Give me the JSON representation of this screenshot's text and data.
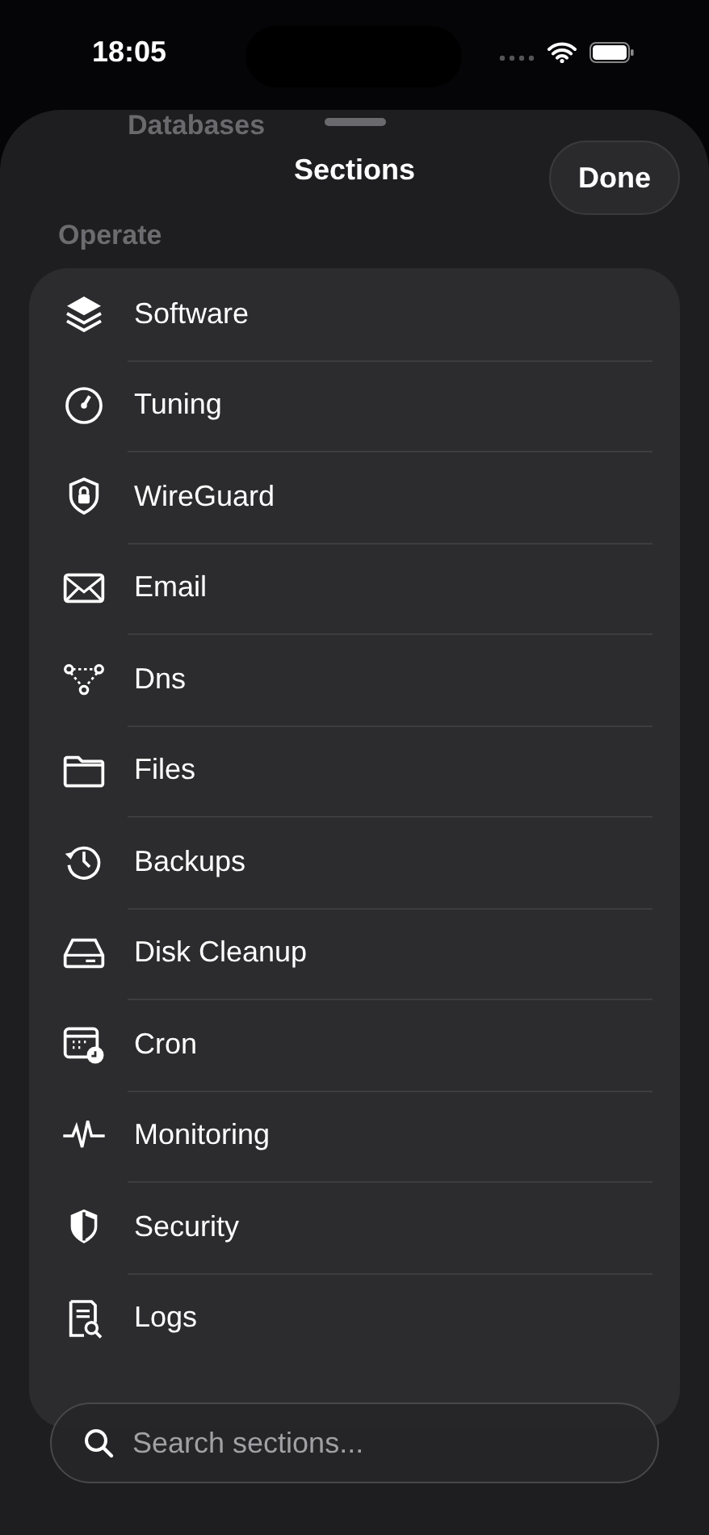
{
  "status_bar": {
    "time": "18:05"
  },
  "background_row": {
    "label": "Databases"
  },
  "sheet": {
    "title": "Sections",
    "done_button": "Done"
  },
  "section": {
    "header": "Operate"
  },
  "items": [
    {
      "label": "Software"
    },
    {
      "label": "Tuning"
    },
    {
      "label": "WireGuard"
    },
    {
      "label": "Email"
    },
    {
      "label": "Dns"
    },
    {
      "label": "Files"
    },
    {
      "label": "Backups"
    },
    {
      "label": "Disk Cleanup"
    },
    {
      "label": "Cron"
    },
    {
      "label": "Monitoring"
    },
    {
      "label": "Security"
    },
    {
      "label": "Logs"
    }
  ],
  "search": {
    "placeholder": "Search sections..."
  }
}
